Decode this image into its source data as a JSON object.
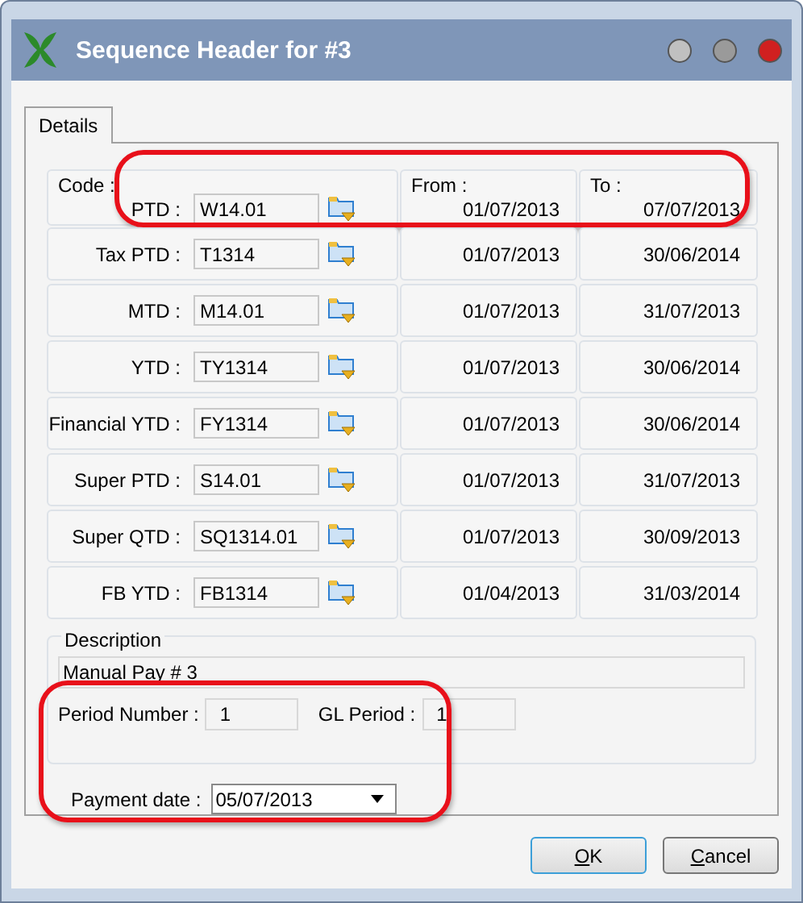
{
  "window": {
    "title": "Sequence Header for #3"
  },
  "tabs": [
    {
      "label": "Details",
      "selected": true
    }
  ],
  "codes": {
    "code_label": "Code :",
    "from_label": "From :",
    "to_label": "To :",
    "rows": [
      {
        "label": "PTD :",
        "code": "W14.01",
        "from": "01/07/2013",
        "to": "07/07/2013",
        "highlighted": true
      },
      {
        "label": "Tax PTD :",
        "code": "T1314",
        "from": "01/07/2013",
        "to": "30/06/2014",
        "highlighted": false
      },
      {
        "label": "MTD :",
        "code": "M14.01",
        "from": "01/07/2013",
        "to": "31/07/2013",
        "highlighted": false
      },
      {
        "label": "YTD :",
        "code": "TY1314",
        "from": "01/07/2013",
        "to": "30/06/2014",
        "highlighted": false
      },
      {
        "label": "Financial YTD :",
        "code": "FY1314",
        "from": "01/07/2013",
        "to": "30/06/2014",
        "highlighted": false
      },
      {
        "label": "Super PTD :",
        "code": "S14.01",
        "from": "01/07/2013",
        "to": "31/07/2013",
        "highlighted": false
      },
      {
        "label": "Super QTD :",
        "code": "SQ1314.01",
        "from": "01/07/2013",
        "to": "30/09/2013",
        "highlighted": false
      },
      {
        "label": "FB YTD :",
        "code": "FB1314",
        "from": "01/04/2013",
        "to": "31/03/2014",
        "highlighted": false
      }
    ]
  },
  "description": {
    "legend": "Description",
    "value": "Manual Pay # 3",
    "period_number_label": "Period Number :",
    "period_number": "1",
    "gl_period_label": "GL Period :",
    "gl_period": "1"
  },
  "payment": {
    "label": "Payment date :",
    "value": "05/07/2013"
  },
  "bottom_highlighted": true,
  "buttons": [
    {
      "label": "OK",
      "default": true
    },
    {
      "label": "Cancel",
      "default": false
    }
  ]
}
